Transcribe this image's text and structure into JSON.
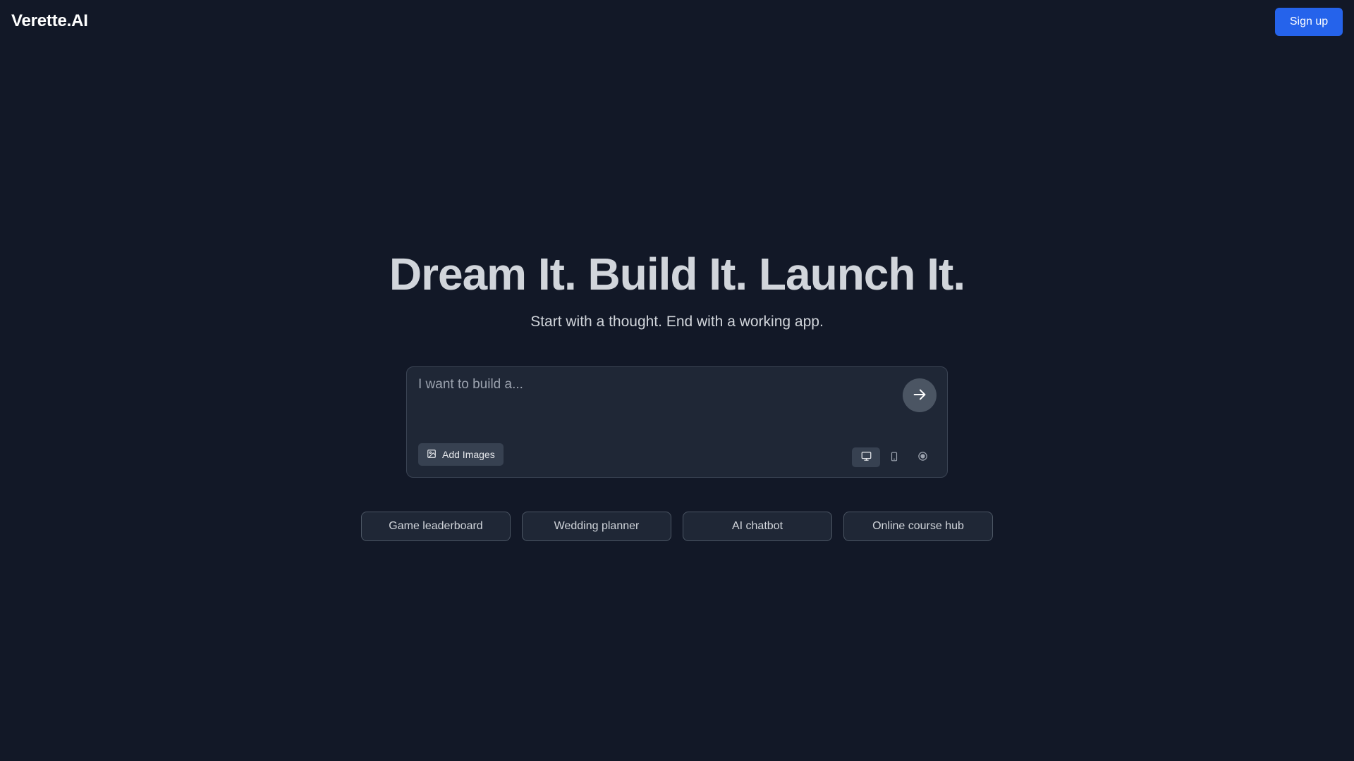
{
  "header": {
    "logo": "Verette.AI",
    "signup_label": "Sign up"
  },
  "hero": {
    "title": "Dream It. Build It. Launch It.",
    "subtitle": "Start with a thought. End with a working app."
  },
  "prompt": {
    "placeholder": "I want to build a...",
    "value": "",
    "add_images_label": "Add Images",
    "send_icon": "arrow-right-icon",
    "devices": [
      {
        "icon": "desktop-icon",
        "active": true
      },
      {
        "icon": "mobile-icon",
        "active": false
      },
      {
        "icon": "target-icon",
        "active": false
      }
    ]
  },
  "suggestions": [
    "Game leaderboard",
    "Wedding planner",
    "AI chatbot",
    "Online course hub"
  ],
  "colors": {
    "background": "#121827",
    "accent": "#2563eb",
    "panel": "#1f2736"
  }
}
